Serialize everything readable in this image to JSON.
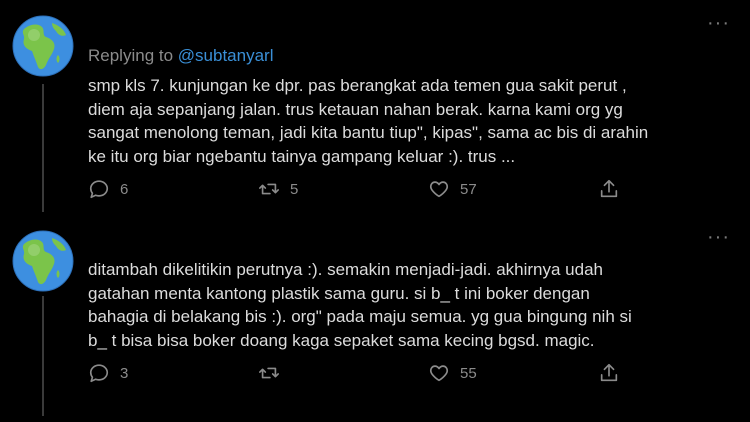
{
  "tweets": [
    {
      "replying_label": "Replying to",
      "replying_handle": "@subtanyarl",
      "body_lines": [
        "smp kls 7. kunjungan ke dpr. pas berangkat ada temen gua sakit perut ,",
        "diem aja sepanjang jalan. trus ketauan nahan berak. karna kami org yg",
        "sangat menolong teman, jadi kita bantu tiup\", kipas\", sama ac bis di arahin",
        "ke itu org biar ngebantu tainya gampang keluar :). trus ..."
      ],
      "reply_count": "6",
      "retweet_count": "5",
      "like_count": "57",
      "share_count": ""
    },
    {
      "body_lines": [
        "ditambah dikelitikin perutnya :). semakin menjadi-jadi. akhirnya udah",
        "gatahan menta kantong plastik sama guru. si b_    t ini boker dengan",
        "bahagia di belakang bis :). org\" pada maju semua. yg gua bingung nih si",
        "b_    t bisa bisa boker doang kaga sepaket sama kecing bgsd. magic."
      ],
      "reply_count": "3",
      "retweet_count": "",
      "like_count": "55",
      "share_count": ""
    }
  ],
  "more_label": "···",
  "colors": {
    "background": "#000000",
    "text": "#dcdcdc",
    "muted": "#8b8b8b",
    "link": "#3a8fd6"
  },
  "icons": [
    "globe-africa-avatar-icon",
    "more-icon",
    "reply-icon",
    "retweet-icon",
    "like-icon",
    "share-icon"
  ]
}
